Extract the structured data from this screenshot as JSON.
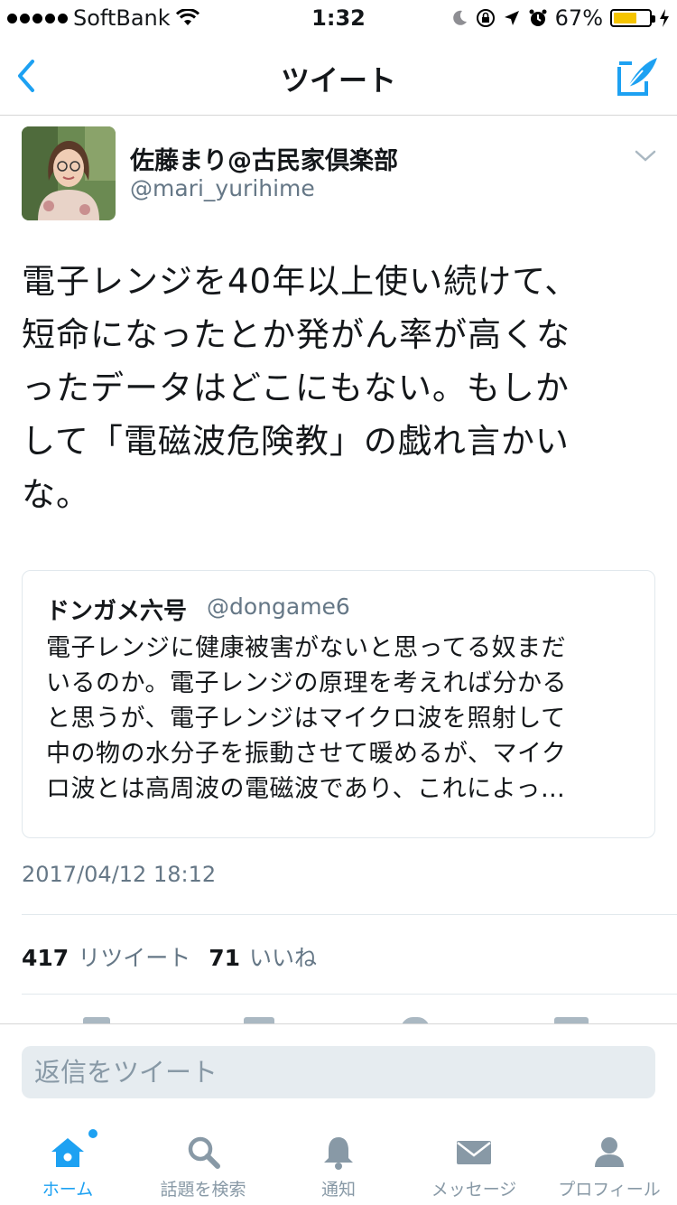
{
  "status_bar": {
    "carrier": "SoftBank",
    "time": "1:32",
    "battery": "67%",
    "battery_level": 0.67
  },
  "nav": {
    "title": "ツイート"
  },
  "tweet": {
    "author_name": "佐藤まり@古民家倶楽部",
    "author_handle": "@mari_yurihime",
    "text": "電子レンジを40年以上使い続けて、\n短命になったとか発がん率が高くな\nったデータはどこにもない。もしか\nして「電磁波危険教」の戯れ言かい\nな。",
    "quote": {
      "name": "ドンガメ六号",
      "handle": "@dongame6",
      "text": "電子レンジに健康被害がないと思ってる奴まだ\nいるのか。電子レンジの原理を考えれば分かる\nと思うが、電子レンジはマイクロ波を照射して\n中の物の水分子を振動させて暖めるが、マイク\nロ波とは高周波の電磁波であり、これによっ…"
    },
    "timestamp": "2017/04/12 18:12",
    "retweet_count": "417",
    "retweet_label": "リツイート",
    "like_count": "71",
    "like_label": "いいね"
  },
  "reply": {
    "placeholder": "返信をツイート"
  },
  "tabs": [
    {
      "label": "ホーム",
      "icon": "home-icon",
      "active": true
    },
    {
      "label": "話題を検索",
      "icon": "search-icon",
      "active": false
    },
    {
      "label": "通知",
      "icon": "bell-icon",
      "active": false
    },
    {
      "label": "メッセージ",
      "icon": "envelope-icon",
      "active": false
    },
    {
      "label": "プロフィール",
      "icon": "profile-icon",
      "active": false
    }
  ],
  "colors": {
    "accent": "#1da1f2",
    "muted": "#657786",
    "battery": "#f5c400"
  }
}
